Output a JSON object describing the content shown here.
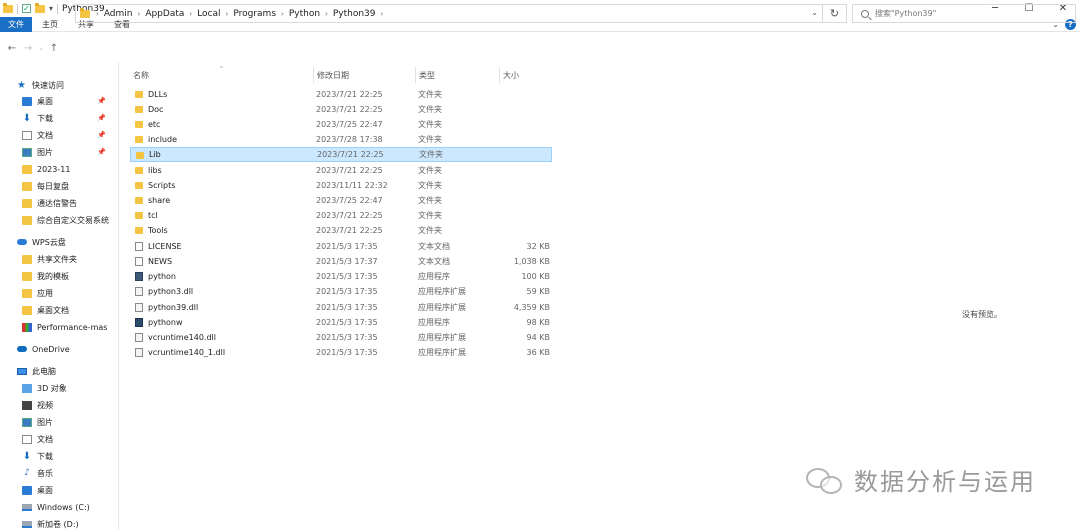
{
  "window": {
    "title": "Python39",
    "controls": [
      "─",
      "☐",
      "✕"
    ]
  },
  "ribbon": {
    "tabs": [
      "文件",
      "主页",
      "共享",
      "查看"
    ],
    "help": "?"
  },
  "address": {
    "crumbs": [
      "Admin",
      "AppData",
      "Local",
      "Programs",
      "Python",
      "Python39"
    ],
    "search_placeholder": "搜索\"Python39\""
  },
  "sidebar": {
    "items": [
      {
        "label": "快速访问",
        "icon": "star-icon"
      },
      {
        "label": "桌面",
        "icon": "desktop-icon",
        "pinned": true
      },
      {
        "label": "下载",
        "icon": "download-icon",
        "pinned": true
      },
      {
        "label": "文档",
        "icon": "document-icon",
        "pinned": true
      },
      {
        "label": "图片",
        "icon": "pictures-icon",
        "pinned": true
      },
      {
        "label": "2023-11",
        "icon": "folder-icon"
      },
      {
        "label": "每日复盘",
        "icon": "folder-icon"
      },
      {
        "label": "通达信警告",
        "icon": "folder-icon"
      },
      {
        "label": "综合自定义交易系统",
        "icon": "folder-icon"
      },
      {
        "label": "WPS云盘",
        "icon": "cloud-icon"
      },
      {
        "label": "共享文件夹",
        "icon": "folder-icon"
      },
      {
        "label": "我的模板",
        "icon": "folder-icon"
      },
      {
        "label": "应用",
        "icon": "folder-icon"
      },
      {
        "label": "桌面文档",
        "icon": "folder-icon"
      },
      {
        "label": "Performance-mas",
        "icon": "performance-icon"
      },
      {
        "label": "OneDrive",
        "icon": "onedrive-icon"
      },
      {
        "label": "此电脑",
        "icon": "computer-icon"
      },
      {
        "label": "3D 对象",
        "icon": "3d-objects-icon"
      },
      {
        "label": "视频",
        "icon": "video-icon"
      },
      {
        "label": "图片",
        "icon": "pictures-icon"
      },
      {
        "label": "文档",
        "icon": "document-icon"
      },
      {
        "label": "下载",
        "icon": "download-icon"
      },
      {
        "label": "音乐",
        "icon": "music-icon"
      },
      {
        "label": "桌面",
        "icon": "desktop-icon"
      },
      {
        "label": "Windows (C:)",
        "icon": "drive-icon"
      },
      {
        "label": "新加卷 (D:)",
        "icon": "drive-icon"
      }
    ]
  },
  "columns": {
    "name": "名称",
    "date": "修改日期",
    "type": "类型",
    "size": "大小"
  },
  "files": [
    {
      "name": "DLLs",
      "date": "2023/7/21 22:25",
      "type": "文件夹",
      "size": "",
      "kind": "folder"
    },
    {
      "name": "Doc",
      "date": "2023/7/21 22:25",
      "type": "文件夹",
      "size": "",
      "kind": "folder"
    },
    {
      "name": "etc",
      "date": "2023/7/25 22:47",
      "type": "文件夹",
      "size": "",
      "kind": "folder"
    },
    {
      "name": "include",
      "date": "2023/7/28 17:38",
      "type": "文件夹",
      "size": "",
      "kind": "folder"
    },
    {
      "name": "Lib",
      "date": "2023/7/21 22:25",
      "type": "文件夹",
      "size": "",
      "kind": "folder",
      "selected": true
    },
    {
      "name": "libs",
      "date": "2023/7/21 22:25",
      "type": "文件夹",
      "size": "",
      "kind": "folder"
    },
    {
      "name": "Scripts",
      "date": "2023/11/11 22:32",
      "type": "文件夹",
      "size": "",
      "kind": "folder"
    },
    {
      "name": "share",
      "date": "2023/7/25 22:47",
      "type": "文件夹",
      "size": "",
      "kind": "folder"
    },
    {
      "name": "tcl",
      "date": "2023/7/21 22:25",
      "type": "文件夹",
      "size": "",
      "kind": "folder"
    },
    {
      "name": "Tools",
      "date": "2023/7/21 22:25",
      "type": "文件夹",
      "size": "",
      "kind": "folder"
    },
    {
      "name": "LICENSE",
      "date": "2021/5/3 17:35",
      "type": "文本文档",
      "size": "32 KB",
      "kind": "txt"
    },
    {
      "name": "NEWS",
      "date": "2021/5/3 17:37",
      "type": "文本文档",
      "size": "1,038 KB",
      "kind": "txt"
    },
    {
      "name": "python",
      "date": "2021/5/3 17:35",
      "type": "应用程序",
      "size": "100 KB",
      "kind": "exe"
    },
    {
      "name": "python3.dll",
      "date": "2021/5/3 17:35",
      "type": "应用程序扩展",
      "size": "59 KB",
      "kind": "dll"
    },
    {
      "name": "python39.dll",
      "date": "2021/5/3 17:35",
      "type": "应用程序扩展",
      "size": "4,359 KB",
      "kind": "dll"
    },
    {
      "name": "pythonw",
      "date": "2021/5/3 17:35",
      "type": "应用程序",
      "size": "98 KB",
      "kind": "exew"
    },
    {
      "name": "vcruntime140.dll",
      "date": "2021/5/3 17:35",
      "type": "应用程序扩展",
      "size": "94 KB",
      "kind": "dll"
    },
    {
      "name": "vcruntime140_1.dll",
      "date": "2021/5/3 17:35",
      "type": "应用程序扩展",
      "size": "36 KB",
      "kind": "dll"
    }
  ],
  "preview_text": "没有预览。",
  "watermark": "数据分析与运用"
}
